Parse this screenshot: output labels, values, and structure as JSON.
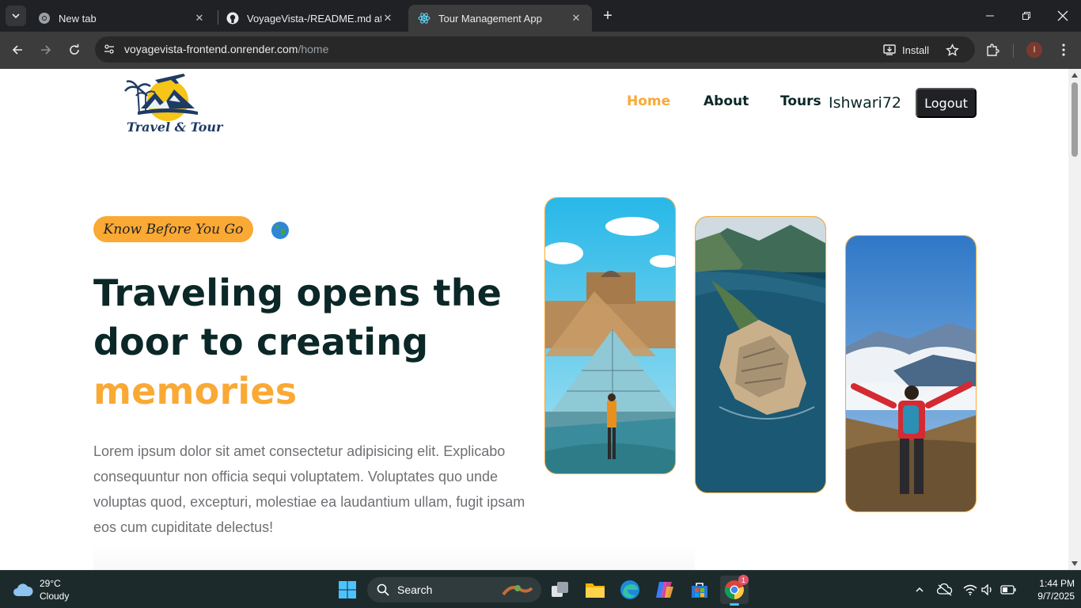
{
  "browser": {
    "tabs": [
      {
        "title": "New tab",
        "icon": "chrome-icon",
        "active": false
      },
      {
        "title": "VoyageVista-/README.md at m",
        "icon": "github-icon",
        "active": false
      },
      {
        "title": "Tour Management App",
        "icon": "react-icon",
        "active": true
      }
    ],
    "url_host": "voyagevista-frontend.onrender.com",
    "url_path": "/home",
    "install_label": "Install",
    "profile_initial": "I"
  },
  "site": {
    "logo_text": "Travel & Tour",
    "nav": {
      "home": "Home",
      "about": "About",
      "tours": "Tours"
    },
    "username": "Ishwari72",
    "logout_label": "Logout",
    "hero": {
      "tagline": "Know Before You Go",
      "title_line1": "Traveling opens the",
      "title_line2": "door to creating",
      "title_highlight": "memories",
      "description": "Lorem ipsum dolor sit amet consectetur adipisicing elit. Explicabo consequuntur non officia sequi voluptatem. Voluptates quo unde voluptas quod, excepturi, molestiae ea laudantium ullam, fugit ipsam eos cum cupiditate delectus!"
    },
    "accent_color": "#faa935",
    "heading_color": "#0b2727"
  },
  "taskbar": {
    "weather_temp": "29°C",
    "weather_desc": "Cloudy",
    "search_label": "Search",
    "time": "1:44 PM",
    "date": "9/7/2025",
    "chrome_badge": "1"
  }
}
